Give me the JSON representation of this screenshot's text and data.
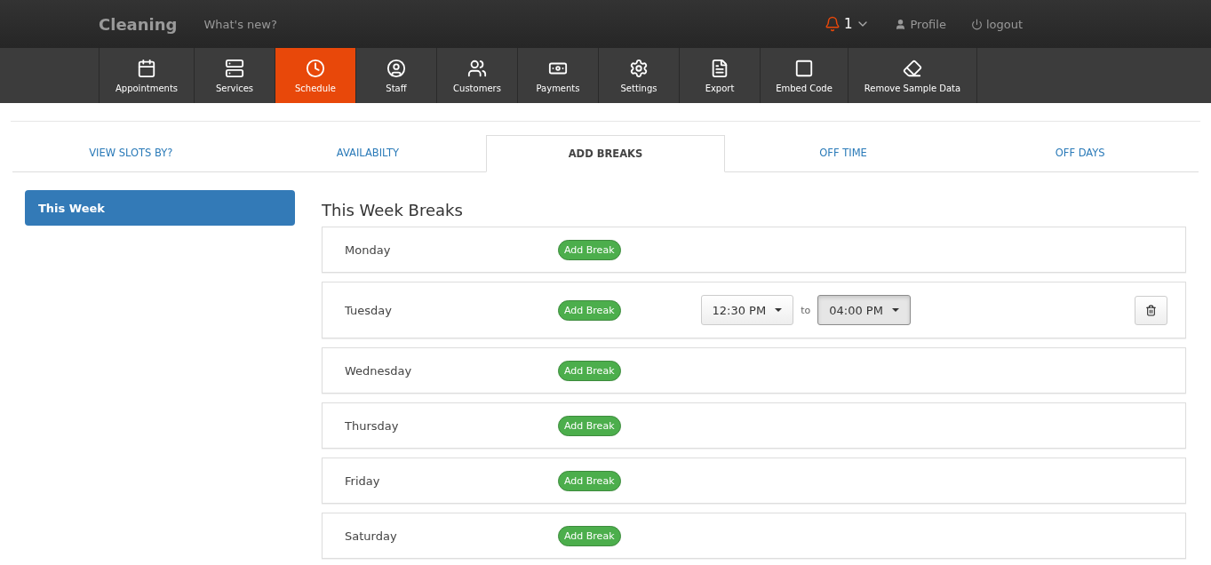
{
  "header": {
    "brand": "Cleaning",
    "whats_new": "What's new?",
    "notifications": {
      "count": "1"
    },
    "profile": "Profile",
    "logout": "logout"
  },
  "nav": [
    {
      "kind": "calendar",
      "label": "Appointments",
      "selected": false
    },
    {
      "kind": "services",
      "label": "Services",
      "selected": false
    },
    {
      "kind": "clock",
      "label": "Schedule",
      "selected": true
    },
    {
      "kind": "user",
      "label": "Staff",
      "selected": false
    },
    {
      "kind": "users",
      "label": "Customers",
      "selected": false
    },
    {
      "kind": "money",
      "label": "Payments",
      "selected": false
    },
    {
      "kind": "gear",
      "label": "Settings",
      "selected": false
    },
    {
      "kind": "pdf",
      "label": "Export",
      "selected": false
    },
    {
      "kind": "square",
      "label": "Embed Code",
      "selected": false
    },
    {
      "kind": "eraser",
      "label": "Remove Sample Data",
      "selected": false
    }
  ],
  "tabs": [
    {
      "label": "VIEW SLOTS BY?",
      "selected": false
    },
    {
      "label": "AVAILABILTY",
      "selected": false
    },
    {
      "label": "ADD BREAKS",
      "selected": true
    },
    {
      "label": "OFF TIME",
      "selected": false
    },
    {
      "label": "OFF DAYS",
      "selected": false
    }
  ],
  "sidebar": {
    "items": [
      {
        "label": "This Week",
        "selected": true
      }
    ]
  },
  "section_title": "This Week Breaks",
  "days": [
    {
      "name": "Monday",
      "button": "Add Break"
    },
    {
      "name": "Tuesday",
      "button": "Add Break",
      "breaks": [
        {
          "from": {
            "value": "12:30 PM",
            "pressed": false
          },
          "separator": "to",
          "to": {
            "value": "04:00 PM",
            "pressed": true
          }
        }
      ]
    },
    {
      "name": "Wednesday",
      "button": "Add Break"
    },
    {
      "name": "Thursday",
      "button": "Add Break"
    },
    {
      "name": "Friday",
      "button": "Add Break"
    },
    {
      "name": "Saturday",
      "button": "Add Break"
    }
  ]
}
